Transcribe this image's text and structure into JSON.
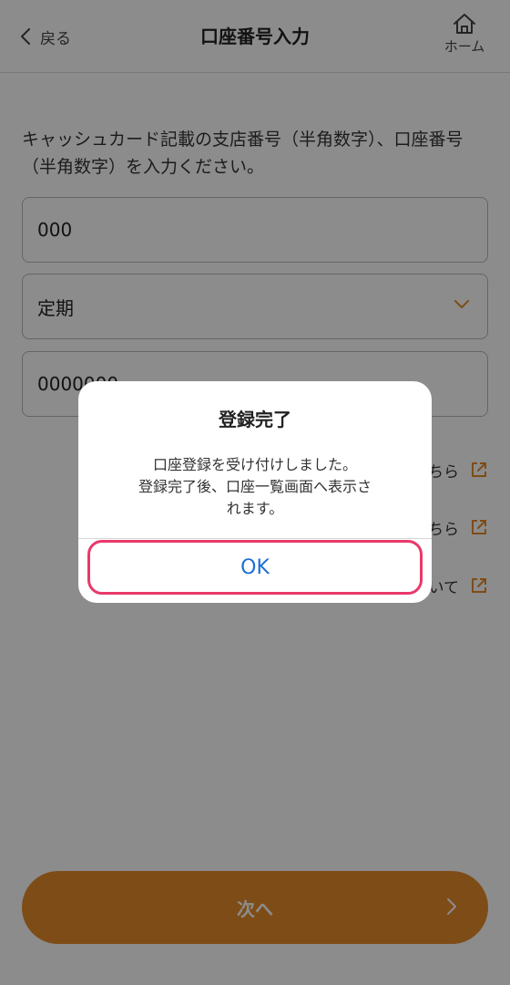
{
  "header": {
    "back_label": "戻る",
    "title": "口座番号入力",
    "home_label": "ホーム"
  },
  "form": {
    "instruction": "キャッシュカード記載の支店番号（半角数字）、口座番号（半角数字）を入力ください。",
    "branch_number_value": "000",
    "account_type_value": "定期",
    "account_number_value": "0000000"
  },
  "links": [
    {
      "label": "ちら"
    },
    {
      "label": "ちら"
    },
    {
      "label": "いて"
    }
  ],
  "next_button": {
    "label": "次へ"
  },
  "dialog": {
    "title": "登録完了",
    "message_lines": [
      "口座登録を受け付けしました。",
      "登録完了後、口座一覧画面へ表示さ",
      "れます。"
    ],
    "ok_label": "OK"
  },
  "colors": {
    "accent_orange": "#e58a2a",
    "link_blue": "#1e6fd6",
    "highlight_pink": "#e8396b"
  }
}
